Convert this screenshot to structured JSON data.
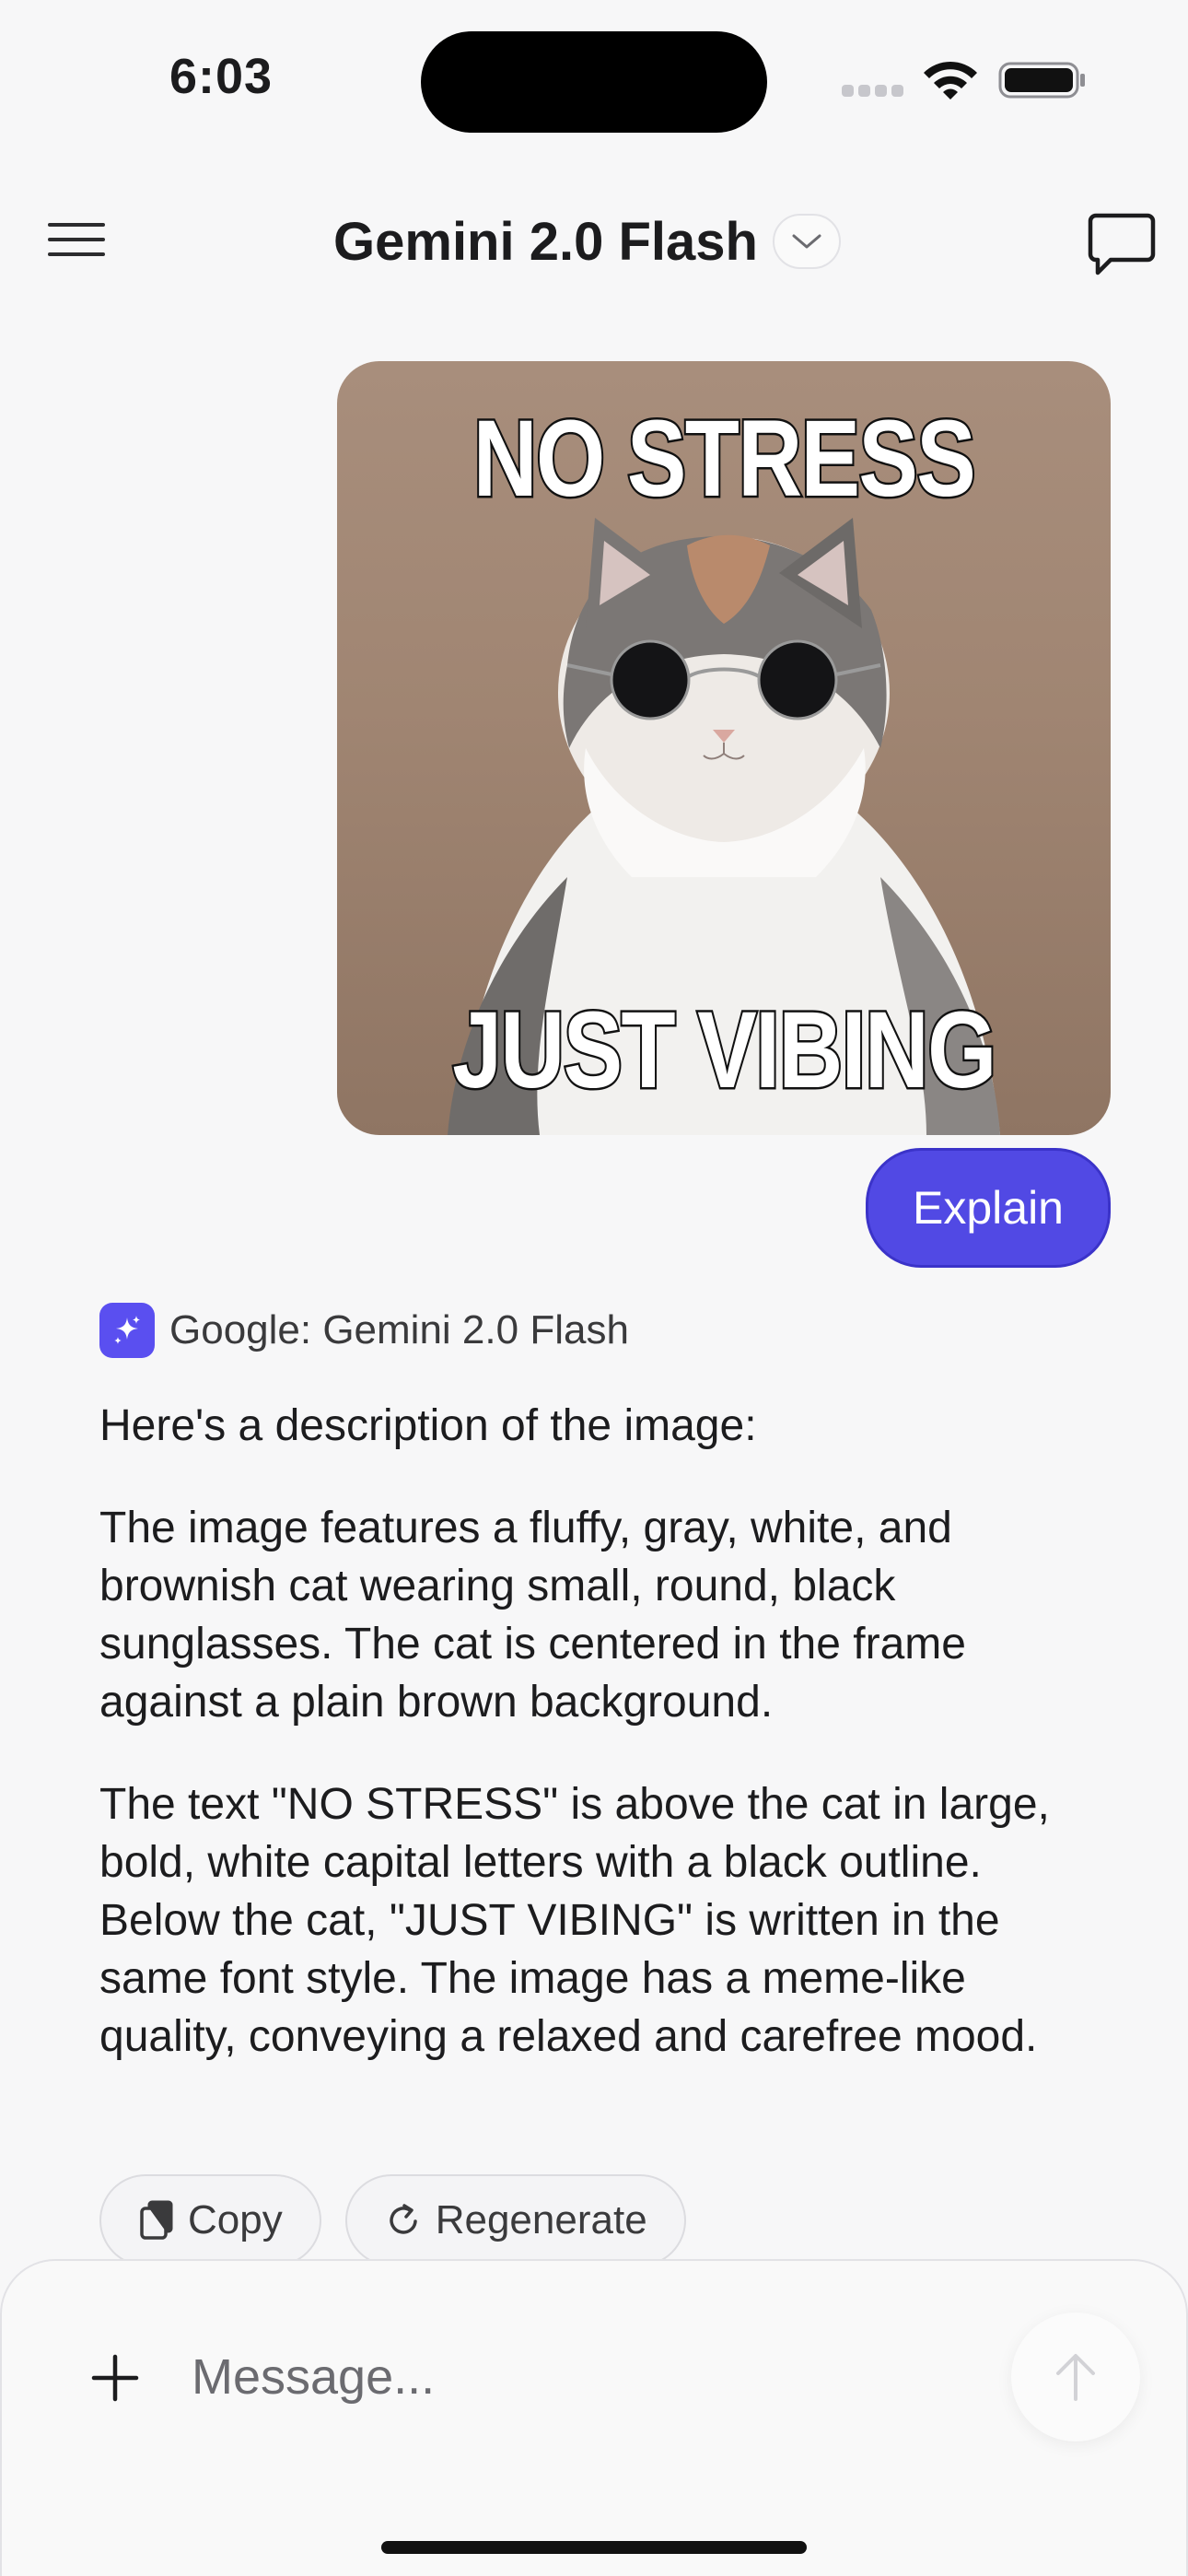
{
  "status_bar": {
    "time": "6:03"
  },
  "header": {
    "title": "Gemini 2.0 Flash"
  },
  "user_message": {
    "image_top_text": "NO STRESS",
    "image_bottom_text": "JUST VIBING",
    "text": "Explain"
  },
  "assistant": {
    "model_label": "Google: Gemini 2.0 Flash",
    "paragraphs": [
      "Here's a description of the image:",
      "The image features a fluffy, gray, white, and brownish cat wearing small, round, black sunglasses. The cat is centered in the frame against a plain brown background.",
      "The text \"NO STRESS\" is above the cat in large, bold, white capital letters with a black outline. Below the cat, \"JUST VIBING\" is written in the same font style. The image has a meme-like quality, conveying a relaxed and carefree mood."
    ],
    "actions": {
      "copy": "Copy",
      "regenerate": "Regenerate"
    }
  },
  "composer": {
    "placeholder": "Message..."
  },
  "colors": {
    "accent": "#5149e4",
    "badge": "#5a4ff0",
    "background": "#f7f7f8"
  }
}
